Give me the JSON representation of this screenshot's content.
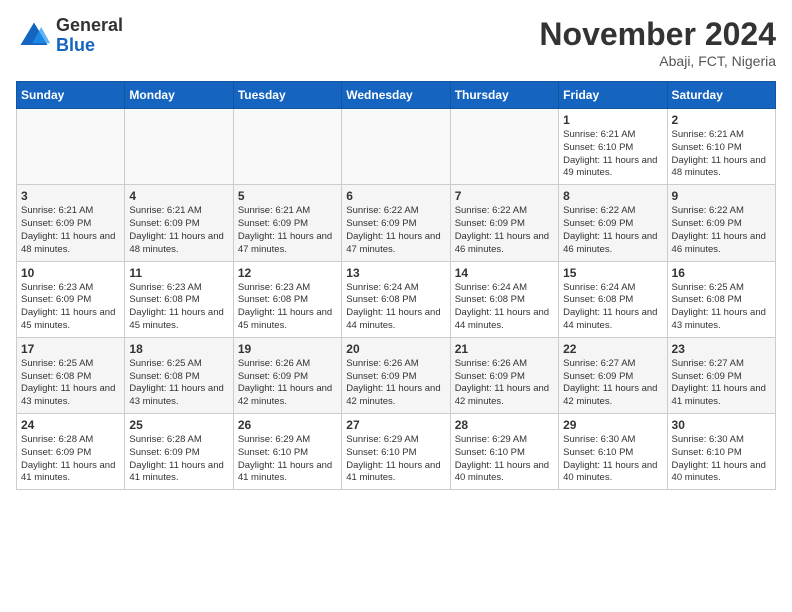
{
  "logo": {
    "general": "General",
    "blue": "Blue"
  },
  "title": "November 2024",
  "location": "Abaji, FCT, Nigeria",
  "days_of_week": [
    "Sunday",
    "Monday",
    "Tuesday",
    "Wednesday",
    "Thursday",
    "Friday",
    "Saturday"
  ],
  "weeks": [
    [
      {
        "day": "",
        "info": ""
      },
      {
        "day": "",
        "info": ""
      },
      {
        "day": "",
        "info": ""
      },
      {
        "day": "",
        "info": ""
      },
      {
        "day": "",
        "info": ""
      },
      {
        "day": "1",
        "info": "Sunrise: 6:21 AM\nSunset: 6:10 PM\nDaylight: 11 hours and 49 minutes."
      },
      {
        "day": "2",
        "info": "Sunrise: 6:21 AM\nSunset: 6:10 PM\nDaylight: 11 hours and 48 minutes."
      }
    ],
    [
      {
        "day": "3",
        "info": "Sunrise: 6:21 AM\nSunset: 6:09 PM\nDaylight: 11 hours and 48 minutes."
      },
      {
        "day": "4",
        "info": "Sunrise: 6:21 AM\nSunset: 6:09 PM\nDaylight: 11 hours and 48 minutes."
      },
      {
        "day": "5",
        "info": "Sunrise: 6:21 AM\nSunset: 6:09 PM\nDaylight: 11 hours and 47 minutes."
      },
      {
        "day": "6",
        "info": "Sunrise: 6:22 AM\nSunset: 6:09 PM\nDaylight: 11 hours and 47 minutes."
      },
      {
        "day": "7",
        "info": "Sunrise: 6:22 AM\nSunset: 6:09 PM\nDaylight: 11 hours and 46 minutes."
      },
      {
        "day": "8",
        "info": "Sunrise: 6:22 AM\nSunset: 6:09 PM\nDaylight: 11 hours and 46 minutes."
      },
      {
        "day": "9",
        "info": "Sunrise: 6:22 AM\nSunset: 6:09 PM\nDaylight: 11 hours and 46 minutes."
      }
    ],
    [
      {
        "day": "10",
        "info": "Sunrise: 6:23 AM\nSunset: 6:09 PM\nDaylight: 11 hours and 45 minutes."
      },
      {
        "day": "11",
        "info": "Sunrise: 6:23 AM\nSunset: 6:08 PM\nDaylight: 11 hours and 45 minutes."
      },
      {
        "day": "12",
        "info": "Sunrise: 6:23 AM\nSunset: 6:08 PM\nDaylight: 11 hours and 45 minutes."
      },
      {
        "day": "13",
        "info": "Sunrise: 6:24 AM\nSunset: 6:08 PM\nDaylight: 11 hours and 44 minutes."
      },
      {
        "day": "14",
        "info": "Sunrise: 6:24 AM\nSunset: 6:08 PM\nDaylight: 11 hours and 44 minutes."
      },
      {
        "day": "15",
        "info": "Sunrise: 6:24 AM\nSunset: 6:08 PM\nDaylight: 11 hours and 44 minutes."
      },
      {
        "day": "16",
        "info": "Sunrise: 6:25 AM\nSunset: 6:08 PM\nDaylight: 11 hours and 43 minutes."
      }
    ],
    [
      {
        "day": "17",
        "info": "Sunrise: 6:25 AM\nSunset: 6:08 PM\nDaylight: 11 hours and 43 minutes."
      },
      {
        "day": "18",
        "info": "Sunrise: 6:25 AM\nSunset: 6:08 PM\nDaylight: 11 hours and 43 minutes."
      },
      {
        "day": "19",
        "info": "Sunrise: 6:26 AM\nSunset: 6:09 PM\nDaylight: 11 hours and 42 minutes."
      },
      {
        "day": "20",
        "info": "Sunrise: 6:26 AM\nSunset: 6:09 PM\nDaylight: 11 hours and 42 minutes."
      },
      {
        "day": "21",
        "info": "Sunrise: 6:26 AM\nSunset: 6:09 PM\nDaylight: 11 hours and 42 minutes."
      },
      {
        "day": "22",
        "info": "Sunrise: 6:27 AM\nSunset: 6:09 PM\nDaylight: 11 hours and 42 minutes."
      },
      {
        "day": "23",
        "info": "Sunrise: 6:27 AM\nSunset: 6:09 PM\nDaylight: 11 hours and 41 minutes."
      }
    ],
    [
      {
        "day": "24",
        "info": "Sunrise: 6:28 AM\nSunset: 6:09 PM\nDaylight: 11 hours and 41 minutes."
      },
      {
        "day": "25",
        "info": "Sunrise: 6:28 AM\nSunset: 6:09 PM\nDaylight: 11 hours and 41 minutes."
      },
      {
        "day": "26",
        "info": "Sunrise: 6:29 AM\nSunset: 6:10 PM\nDaylight: 11 hours and 41 minutes."
      },
      {
        "day": "27",
        "info": "Sunrise: 6:29 AM\nSunset: 6:10 PM\nDaylight: 11 hours and 41 minutes."
      },
      {
        "day": "28",
        "info": "Sunrise: 6:29 AM\nSunset: 6:10 PM\nDaylight: 11 hours and 40 minutes."
      },
      {
        "day": "29",
        "info": "Sunrise: 6:30 AM\nSunset: 6:10 PM\nDaylight: 11 hours and 40 minutes."
      },
      {
        "day": "30",
        "info": "Sunrise: 6:30 AM\nSunset: 6:10 PM\nDaylight: 11 hours and 40 minutes."
      }
    ]
  ]
}
